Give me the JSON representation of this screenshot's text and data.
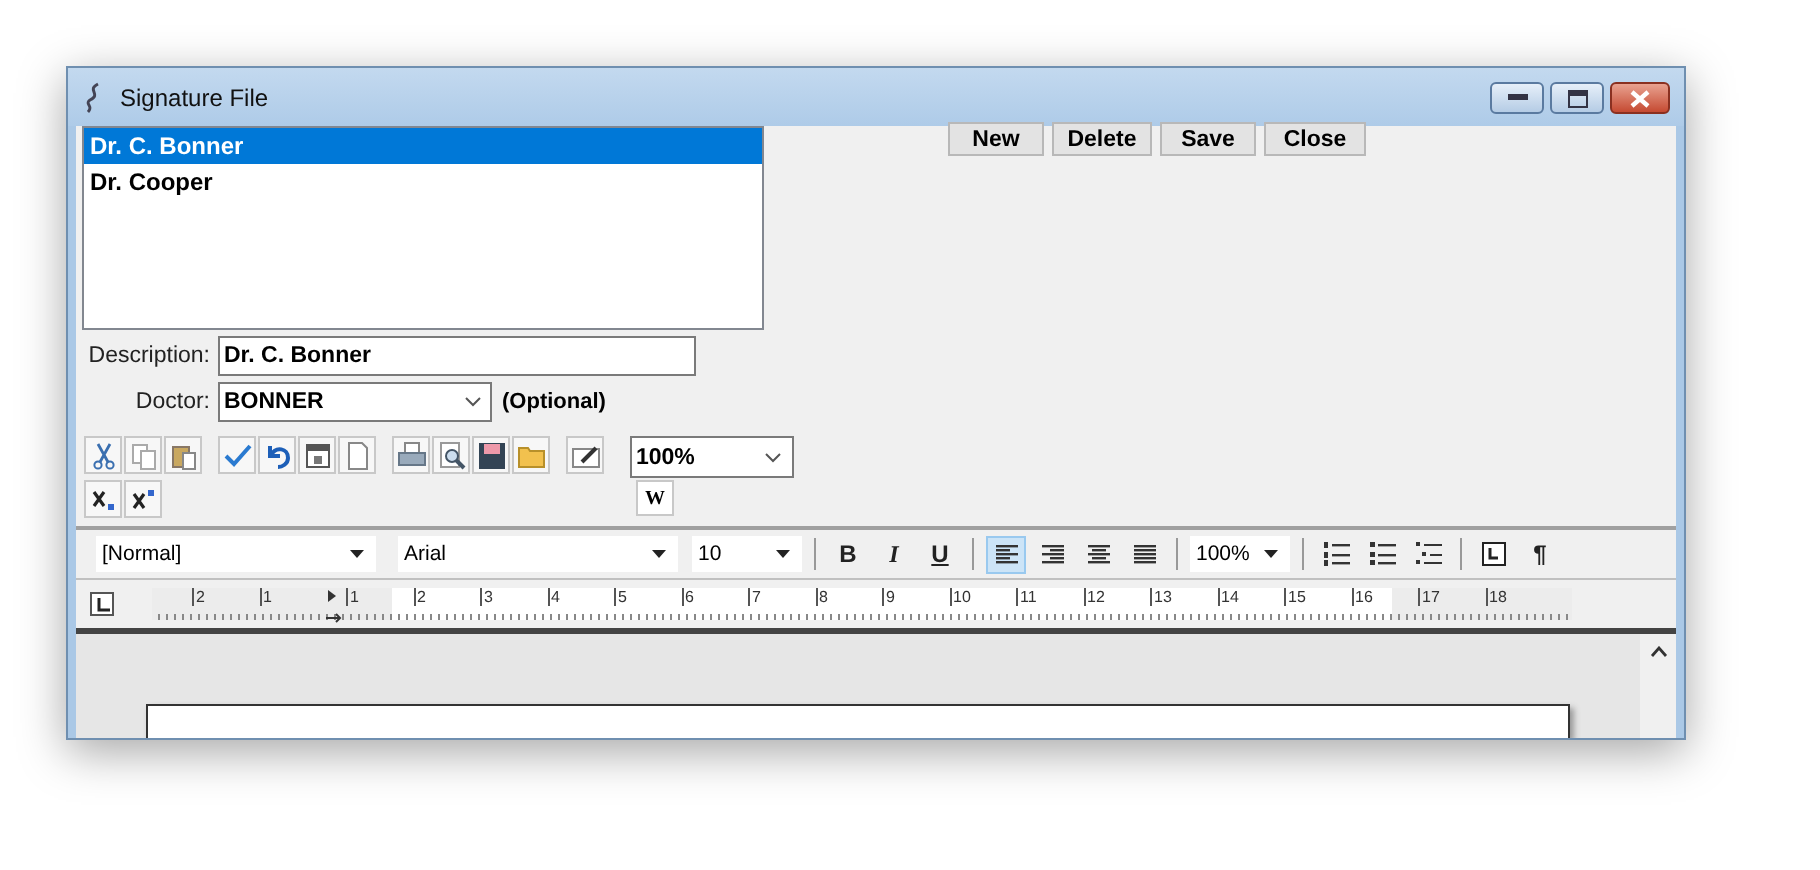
{
  "window": {
    "title": "Signature File"
  },
  "signatures": [
    {
      "label": "Dr. C. Bonner",
      "selected": true
    },
    {
      "label": "Dr. Cooper",
      "selected": false
    }
  ],
  "buttons": [
    "New",
    "Delete",
    "Save",
    "Close"
  ],
  "description": {
    "label": "Description:",
    "value": "Dr. C. Bonner"
  },
  "doctor": {
    "label": "Doctor:",
    "value": "BONNER",
    "note": "(Optional)"
  },
  "zoom": {
    "value": "100%"
  },
  "word_button": "W",
  "format_bar": {
    "style": "[Normal]",
    "font": "Arial",
    "size": "10",
    "bold": "B",
    "italic": "I",
    "underline": "U",
    "alignment": [
      {
        "kind": "left",
        "selected": true
      },
      {
        "kind": "right",
        "selected": false
      },
      {
        "kind": "center",
        "selected": false
      },
      {
        "kind": "justify",
        "selected": false
      }
    ],
    "zoom": "100%",
    "pilcrow": "¶"
  },
  "ruler": {
    "labels_before": [
      "2",
      "1"
    ],
    "labels_after": [
      "1",
      "2",
      "3",
      "4",
      "5",
      "6",
      "7",
      "8",
      "9",
      "10",
      "11",
      "12",
      "13",
      "14",
      "15",
      "16",
      "17",
      "18"
    ]
  }
}
